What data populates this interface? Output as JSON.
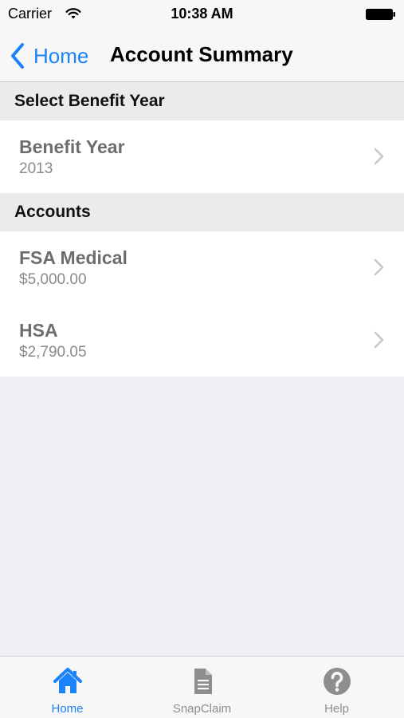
{
  "status_bar": {
    "carrier": "Carrier",
    "time": "10:38 AM",
    "wifi_icon": "wifi-icon",
    "battery_icon": "battery-icon"
  },
  "nav": {
    "back_label": "Home",
    "back_icon": "chevron-left-icon",
    "title": "Account Summary"
  },
  "sections": {
    "benefit_year_header": "Select Benefit Year",
    "accounts_header": "Accounts"
  },
  "benefit_year_row": {
    "title": "Benefit Year",
    "value": "2013"
  },
  "accounts": [
    {
      "title": "FSA Medical",
      "value": "$5,000.00"
    },
    {
      "title": "HSA",
      "value": "$2,790.05"
    }
  ],
  "tabs": [
    {
      "label": "Home",
      "icon": "house-icon",
      "active": true
    },
    {
      "label": "SnapClaim",
      "icon": "document-icon",
      "active": false
    },
    {
      "label": "Help",
      "icon": "help-icon",
      "active": false
    }
  ],
  "colors": {
    "accent": "#1a82fb",
    "inactive": "#8e8e8e",
    "background": "#efeff4"
  }
}
